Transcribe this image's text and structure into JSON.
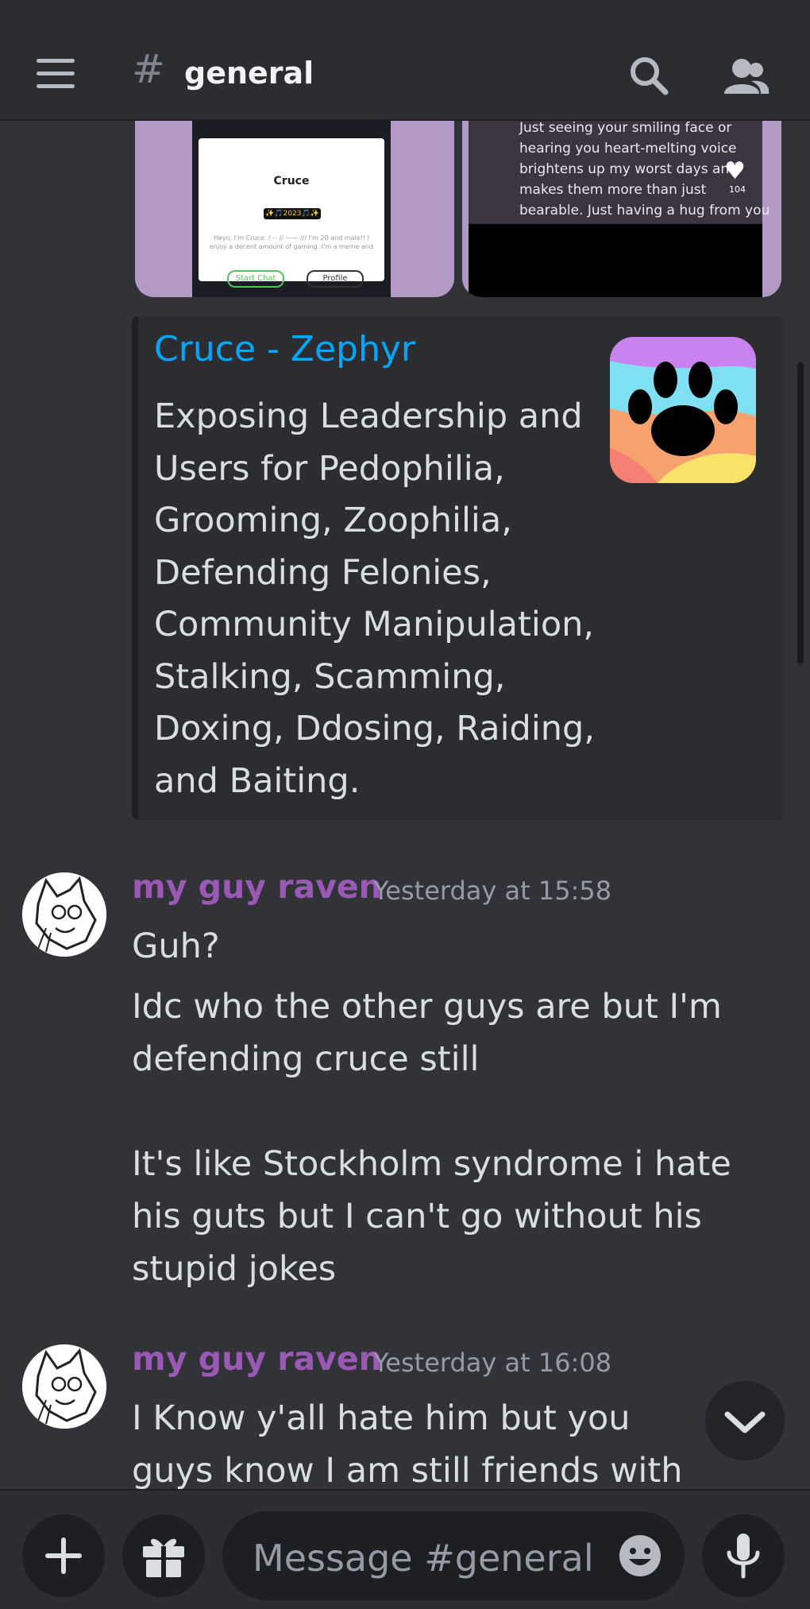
{
  "header": {
    "channel_hash": "#",
    "channel_name": "general"
  },
  "attachments": {
    "left": {
      "username": "Cruce",
      "year_badge": "✨🎵2023🎵✨",
      "bio": "Heyo, I'm Cruce. / -- // —— /// I'm 20 and male!! I enjoy a decent amount of gaming. I'm a meme and",
      "start_chat": "Start Chat",
      "profile": "Profile"
    },
    "right": {
      "quote": "Just seeing your smiling face or hearing you heart-melting voice brightens up my worst days and makes them more than just bearable. Just having a hug from you",
      "like_count": "104"
    }
  },
  "embed": {
    "title": "Cruce - Zephyr",
    "description": "Exposing Leadership and Users for Pedophilia, Grooming, Zoophilia, Defending Felonies, Community Manipulation, Stalking, Scamming, Doxing, Ddosing, Raiding, and Baiting.",
    "accent_color": "#00a8fc"
  },
  "messages": [
    {
      "author": "my guy raven",
      "timestamp": "Yesterday at 15:58",
      "line1": "Guh?",
      "line2": "Idc who the other guys are but I'm defending cruce still\n\nIt's like Stockholm syndrome i hate his guts but I can't go without his stupid jokes"
    },
    {
      "author": "my guy raven",
      "timestamp": "Yesterday at 16:08",
      "line1": "I Know y'all hate him but you guys know I am still friends with Percy"
    }
  ],
  "composer": {
    "placeholder": "Message #general"
  },
  "icons": [
    "hamburger-icon",
    "search-icon",
    "members-icon",
    "paw-icon",
    "chevron-down-icon",
    "plus-icon",
    "gift-icon",
    "emoji-icon",
    "microphone-icon"
  ],
  "colors": {
    "background": "#313338",
    "author": "#9b59b6",
    "link": "#00a8fc"
  }
}
